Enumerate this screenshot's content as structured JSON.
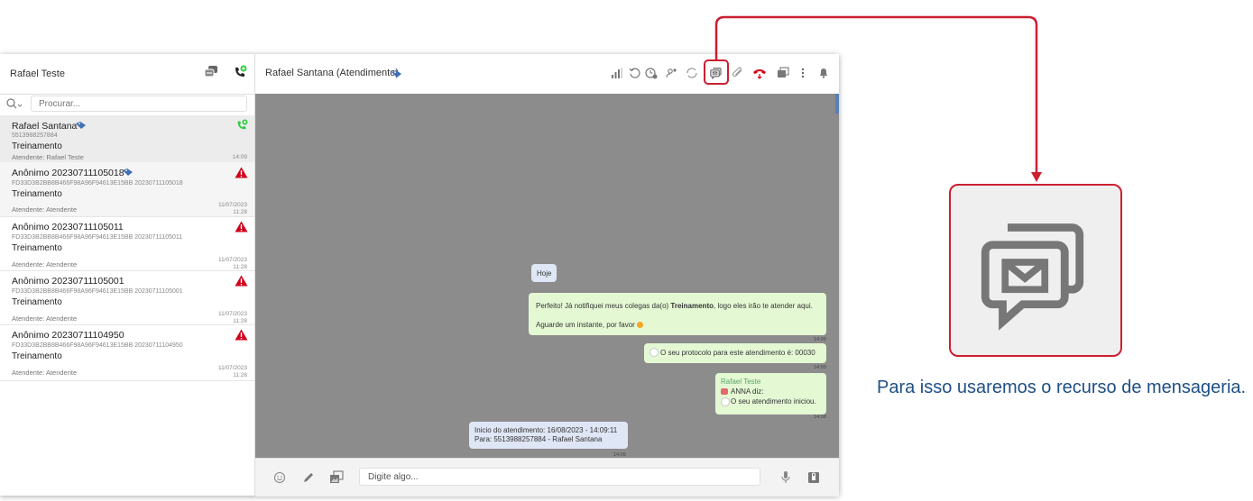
{
  "sidebar": {
    "title": "Rafael Teste",
    "search_placeholder": "Procurar...",
    "conversations": [
      {
        "name": "Rafael Santana",
        "number": "5513988257884",
        "queue": "Treinamento",
        "agent": "Atendente: Rafael Teste",
        "time": "14:09"
      },
      {
        "name": "Anônimo 20230711105018",
        "number": "FD33D3B2BB8B466F98A96F94613E15BB 20230711105018",
        "queue": "Treinamento",
        "agent": "Atendente: Atendente",
        "date": "11/07/2023",
        "time": "11:28"
      },
      {
        "name": "Anônimo 20230711105011",
        "number": "FD33D3B2BB8B466F98A96F94613E15BB 20230711105011",
        "queue": "Treinamento",
        "agent": "Atendente: Atendente",
        "date": "11/07/2023",
        "time": "11:28"
      },
      {
        "name": "Anônimo 20230711105001",
        "number": "FD33D3B2BB8B466F98A96F94613E15BB 20230711105001",
        "queue": "Treinamento",
        "agent": "Atendente: Atendente",
        "date": "11/07/2023",
        "time": "11:28"
      },
      {
        "name": "Anônimo 20230711104950",
        "number": "FD33D3B2BB8B466F98A96F94613E15BB 20230711104950",
        "queue": "Treinamento",
        "agent": "Atendente: Atendente",
        "date": "11/07/2023",
        "time": "11:28"
      }
    ]
  },
  "chat": {
    "title": "Rafael Santana (Atendimento)",
    "day_label": "Hoje",
    "msg1_pre": "Perfeito! Já notifiquei meus colegas da(o) ",
    "msg1_bold": "Treinamento",
    "msg1_post": ", logo eles irão te atender aqui.",
    "msg1_line2": "Aguarde um instante, por favor",
    "msg1_time": "14:09",
    "msg2_text": "O seu protocolo para este atendimento é: 00030",
    "msg2_time": "14:09",
    "msg3_sender": "Rafael Teste",
    "msg3_line1": "ANNA diz:",
    "msg3_line2": "O seu atendimento iniciou.",
    "msg3_time": "14:09",
    "msg4_line1": "Inicio do atendimento: 16/08/2023 - 14:09:11",
    "msg4_line2": "Para: 5513988257884 - Rafael Santana",
    "msg4_time": "14:09",
    "composer_placeholder": "Digite algo..."
  },
  "caption": "Para isso usaremos o recurso de mensageria.",
  "colors": {
    "highlight": "#cc1f2f",
    "caption_text": "#1e4f86",
    "chat_background": "#8c8c8c",
    "bubble_green": "#e4f8d4",
    "bubble_blue": "#dfe6f5",
    "alert_red": "#d0021b",
    "call_green": "#2ecc40"
  },
  "icons": [
    "chat-bubbles-icon",
    "phone-add-icon",
    "search-icon",
    "tag-icon",
    "warning-icon",
    "signal-icon",
    "history-icon",
    "clock-icon",
    "transfer-icon",
    "refresh-icon",
    "messaging-icon",
    "attach-icon",
    "hangup-icon",
    "window-icon",
    "more-icon",
    "bell-icon",
    "emoji-icon",
    "pencil-icon",
    "gallery-icon",
    "mic-icon",
    "lock-upload-icon"
  ]
}
